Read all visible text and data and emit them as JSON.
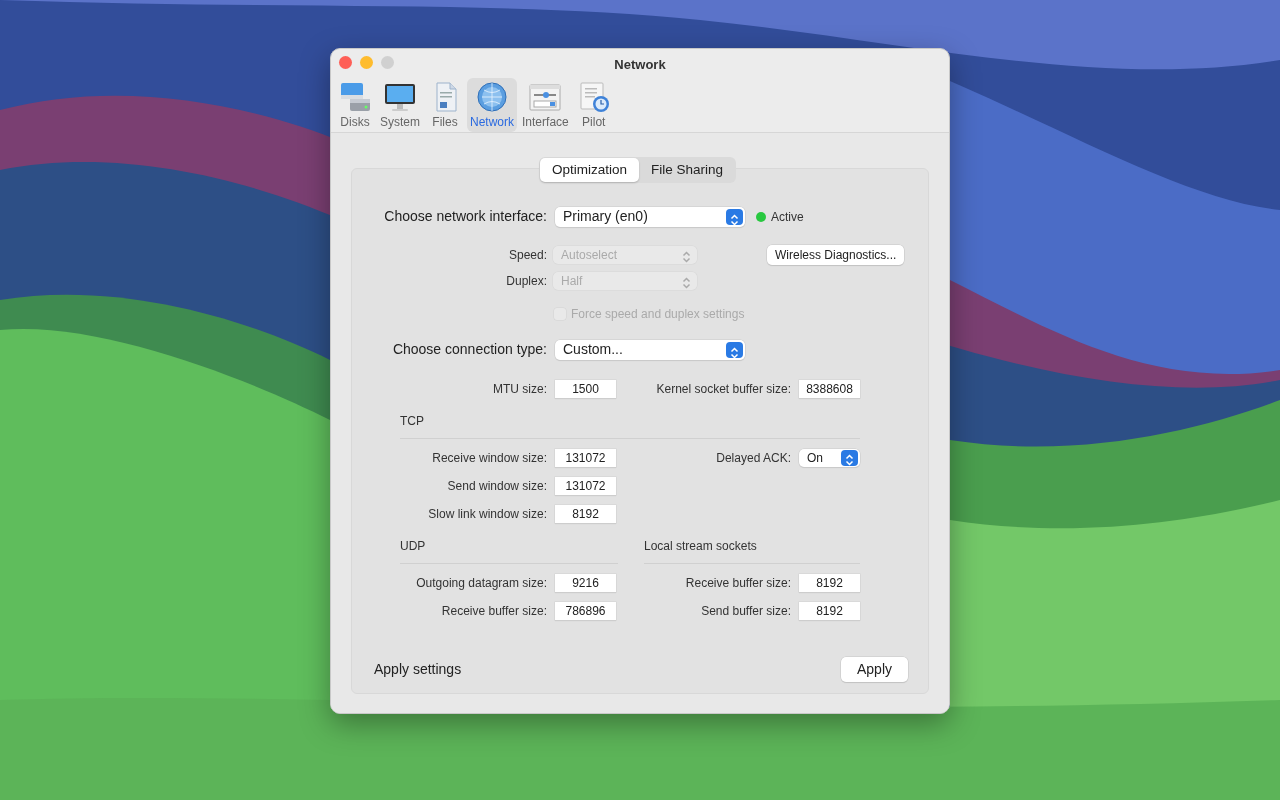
{
  "window": {
    "title": "Network"
  },
  "toolbar": [
    {
      "label": "Disks",
      "kind": "disks",
      "selected": false
    },
    {
      "label": "System",
      "kind": "system",
      "selected": false
    },
    {
      "label": "Files",
      "kind": "files",
      "selected": false
    },
    {
      "label": "Network",
      "kind": "network",
      "selected": true
    },
    {
      "label": "Interface",
      "kind": "interface",
      "selected": false
    },
    {
      "label": "Pilot",
      "kind": "pilot",
      "selected": false
    }
  ],
  "tabs": [
    {
      "label": "Optimization",
      "selected": true
    },
    {
      "label": "File Sharing",
      "selected": false
    }
  ],
  "interface": {
    "label": "Choose network interface:",
    "value": "Primary (en0)",
    "status": "Active"
  },
  "speed": {
    "label": "Speed:",
    "value": "Autoselect",
    "disabled": true
  },
  "duplex": {
    "label": "Duplex:",
    "value": "Half",
    "disabled": true
  },
  "force": {
    "label": "Force speed and duplex settings",
    "checked": false,
    "disabled": true
  },
  "diagnostics_button": "Wireless Diagnostics...",
  "connection": {
    "label": "Choose connection type:",
    "value": "Custom..."
  },
  "mtu": {
    "label": "MTU size:",
    "value": "1500"
  },
  "kernel_buffer": {
    "label": "Kernel socket buffer size:",
    "value": "8388608"
  },
  "tcp": {
    "title": "TCP",
    "fields": [
      {
        "label": "Receive window size:",
        "value": "131072"
      },
      {
        "label": "Send window size:",
        "value": "131072"
      },
      {
        "label": "Slow link window size:",
        "value": "8192"
      }
    ],
    "delayed_ack": {
      "label": "Delayed ACK:",
      "value": "On"
    }
  },
  "udp": {
    "title": "UDP",
    "fields": [
      {
        "label": "Outgoing datagram size:",
        "value": "9216"
      },
      {
        "label": "Receive buffer size:",
        "value": "786896"
      }
    ]
  },
  "local_stream": {
    "title": "Local stream sockets",
    "fields": [
      {
        "label": "Receive buffer size:",
        "value": "8192"
      },
      {
        "label": "Send buffer size:",
        "value": "8192"
      }
    ]
  },
  "apply": {
    "label": "Apply settings",
    "button": "Apply"
  }
}
